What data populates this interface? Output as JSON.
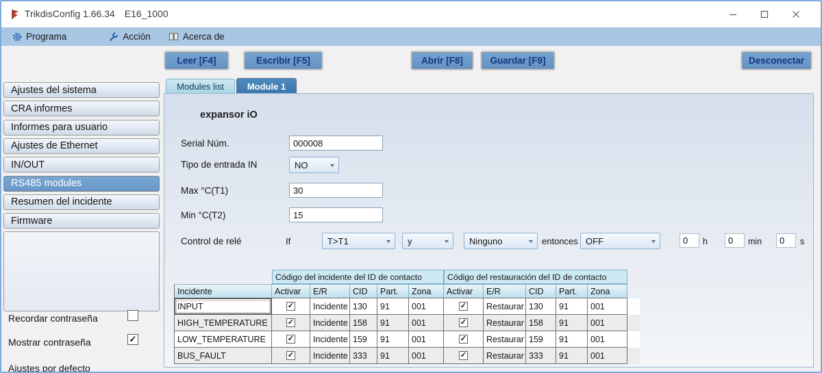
{
  "window": {
    "title": "TrikdisConfig 1.66.34",
    "device": "E16_1000"
  },
  "menubar": {
    "items": [
      {
        "label": "Programa",
        "icon": "gear-icon"
      },
      {
        "label": "Acción",
        "icon": "wrench-icon"
      },
      {
        "label": "Acerca de",
        "icon": "book-icon"
      }
    ]
  },
  "toolbar": {
    "read": "Leer [F4]",
    "write": "Escribir [F5]",
    "open": "Abrir [F8]",
    "save": "Guardar [F9]",
    "disconnect": "Desconectar"
  },
  "sidebar": {
    "items": [
      {
        "label": "Ajustes del sistema",
        "selected": false
      },
      {
        "label": "CRA informes",
        "selected": false
      },
      {
        "label": "Informes para usuario",
        "selected": false
      },
      {
        "label": "Ajustes de Ethernet",
        "selected": false
      },
      {
        "label": "IN/OUT",
        "selected": false
      },
      {
        "label": "RS485 modules",
        "selected": true
      },
      {
        "label": "Resumen del incidente",
        "selected": false
      },
      {
        "label": "Firmware",
        "selected": false
      }
    ],
    "options": [
      {
        "label": "Recordar contraseña",
        "checked": false
      },
      {
        "label": "Mostrar contraseña",
        "checked": true
      }
    ],
    "defaults_label": "Ajustes por defecto"
  },
  "main": {
    "tabs": [
      {
        "label": "Modules list",
        "active": false
      },
      {
        "label": "Module 1",
        "active": true
      }
    ],
    "module_title": "expansor iO",
    "fields": {
      "serial": {
        "label": "Serial Núm.",
        "value": "000008"
      },
      "input_type": {
        "label": "Tipo de entrada IN",
        "value": "NO"
      },
      "max_temp": {
        "label": "Max °C(T1)",
        "value": "30"
      },
      "min_temp": {
        "label": "Min °C(T2)",
        "value": "15"
      }
    },
    "relay": {
      "label": "Control de relé",
      "if_label": "If",
      "condition1": "T>T1",
      "operator": "y",
      "condition2": "Ninguno",
      "then_label": "entonces",
      "action": "OFF",
      "hours": {
        "value": "0",
        "unit": "h"
      },
      "minutes": {
        "value": "0",
        "unit": "min"
      },
      "seconds": {
        "value": "0",
        "unit": "s"
      }
    },
    "table": {
      "group_headers": [
        "Código del incidente del ID de contacto",
        "Código del restauración del ID de contacto"
      ],
      "columns": [
        "Incidente",
        "Activar",
        "E/R",
        "CID",
        "Part.",
        "Zona",
        "Activar",
        "E/R",
        "CID",
        "Part.",
        "Zona"
      ],
      "rows": [
        {
          "incident": "INPUT",
          "event": {
            "enabled": true,
            "er": "Incidente",
            "cid": "130",
            "part": "91",
            "zone": "001"
          },
          "restore": {
            "enabled": true,
            "er": "Restaurar",
            "cid": "130",
            "part": "91",
            "zone": "001"
          }
        },
        {
          "incident": "HIGH_TEMPERATURE",
          "event": {
            "enabled": true,
            "er": "Incidente",
            "cid": "158",
            "part": "91",
            "zone": "001"
          },
          "restore": {
            "enabled": true,
            "er": "Restaurar",
            "cid": "158",
            "part": "91",
            "zone": "001"
          }
        },
        {
          "incident": "LOW_TEMPERATURE",
          "event": {
            "enabled": true,
            "er": "Incidente",
            "cid": "159",
            "part": "91",
            "zone": "001"
          },
          "restore": {
            "enabled": true,
            "er": "Restaurar",
            "cid": "159",
            "part": "91",
            "zone": "001"
          }
        },
        {
          "incident": "BUS_FAULT",
          "event": {
            "enabled": true,
            "er": "Incidente",
            "cid": "333",
            "part": "91",
            "zone": "001"
          },
          "restore": {
            "enabled": true,
            "er": "Restaurar",
            "cid": "333",
            "part": "91",
            "zone": "001"
          }
        }
      ]
    }
  },
  "colors": {
    "menubar": "#a9c7e3",
    "toolbar_button_fill": "#6d9bcb",
    "toolbar_button_text": "#16357d",
    "sidebar_selected": "#6f9ed0",
    "tab_active": "#3d7cb4",
    "table_header": "#cde9f3",
    "panel_top": "#d5dfec"
  }
}
